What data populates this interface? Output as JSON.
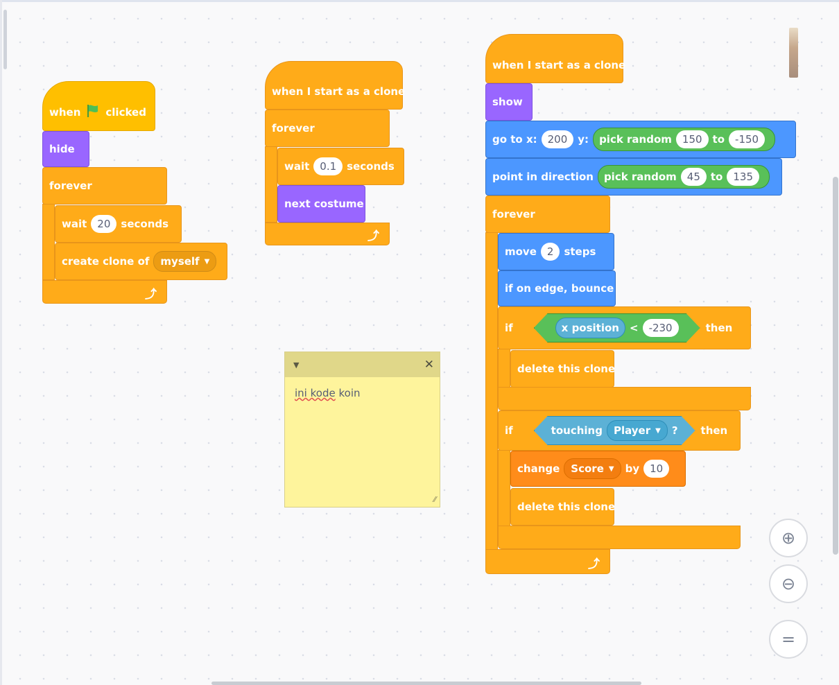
{
  "script1": {
    "hat_when": "when",
    "hat_clicked": "clicked",
    "hide": "hide",
    "forever": "forever",
    "wait": "wait",
    "wait_value": "20",
    "seconds": "seconds",
    "create_clone_of": "create clone of",
    "clone_target": "myself"
  },
  "script2": {
    "hat": "when I start as a clone",
    "forever": "forever",
    "wait": "wait",
    "wait_value": "0.1",
    "seconds": "seconds",
    "next_costume": "next costume"
  },
  "script3": {
    "hat": "when I start as a clone",
    "show": "show",
    "goto_x": "go to x:",
    "x_value": "200",
    "y_label": "y:",
    "pick_random": "pick random",
    "y_from": "150",
    "to": "to",
    "y_to": "-150",
    "point_in_direction": "point in direction",
    "dir_from": "45",
    "dir_to": "135",
    "forever": "forever",
    "move": "move",
    "move_value": "2",
    "steps": "steps",
    "if_on_edge_bounce": "if on edge, bounce",
    "if": "if",
    "then": "then",
    "x_position": "x position",
    "less_than": "<",
    "compare_value": "-230",
    "delete_this_clone": "delete this clone",
    "touching": "touching",
    "touching_target": "Player",
    "question": "?",
    "change": "change",
    "variable": "Score",
    "by": "by",
    "change_value": "10"
  },
  "note": {
    "text_underlined": "ini kode",
    "text_rest": "koin"
  },
  "glyphs": {
    "flag_color": "#4cbf56",
    "loop_arrow": "⤴",
    "caret": "▼",
    "close": "✕",
    "resize": "⁄⁄",
    "zoom_in": "⊕",
    "zoom_out": "⊖",
    "zoom_reset": "="
  },
  "colors": {
    "events": "#ffbf00",
    "control": "#ffab19",
    "looks": "#9966ff",
    "motion": "#4c97ff",
    "operators": "#59c059",
    "sensing": "#5cb1d6",
    "variables": "#ff8c1a",
    "note": "#fef49c"
  },
  "icons": [
    "green-flag-icon",
    "loop-arrow-icon",
    "dropdown-caret-icon",
    "close-icon",
    "zoom-in-icon",
    "zoom-out-icon",
    "zoom-reset-icon"
  ]
}
